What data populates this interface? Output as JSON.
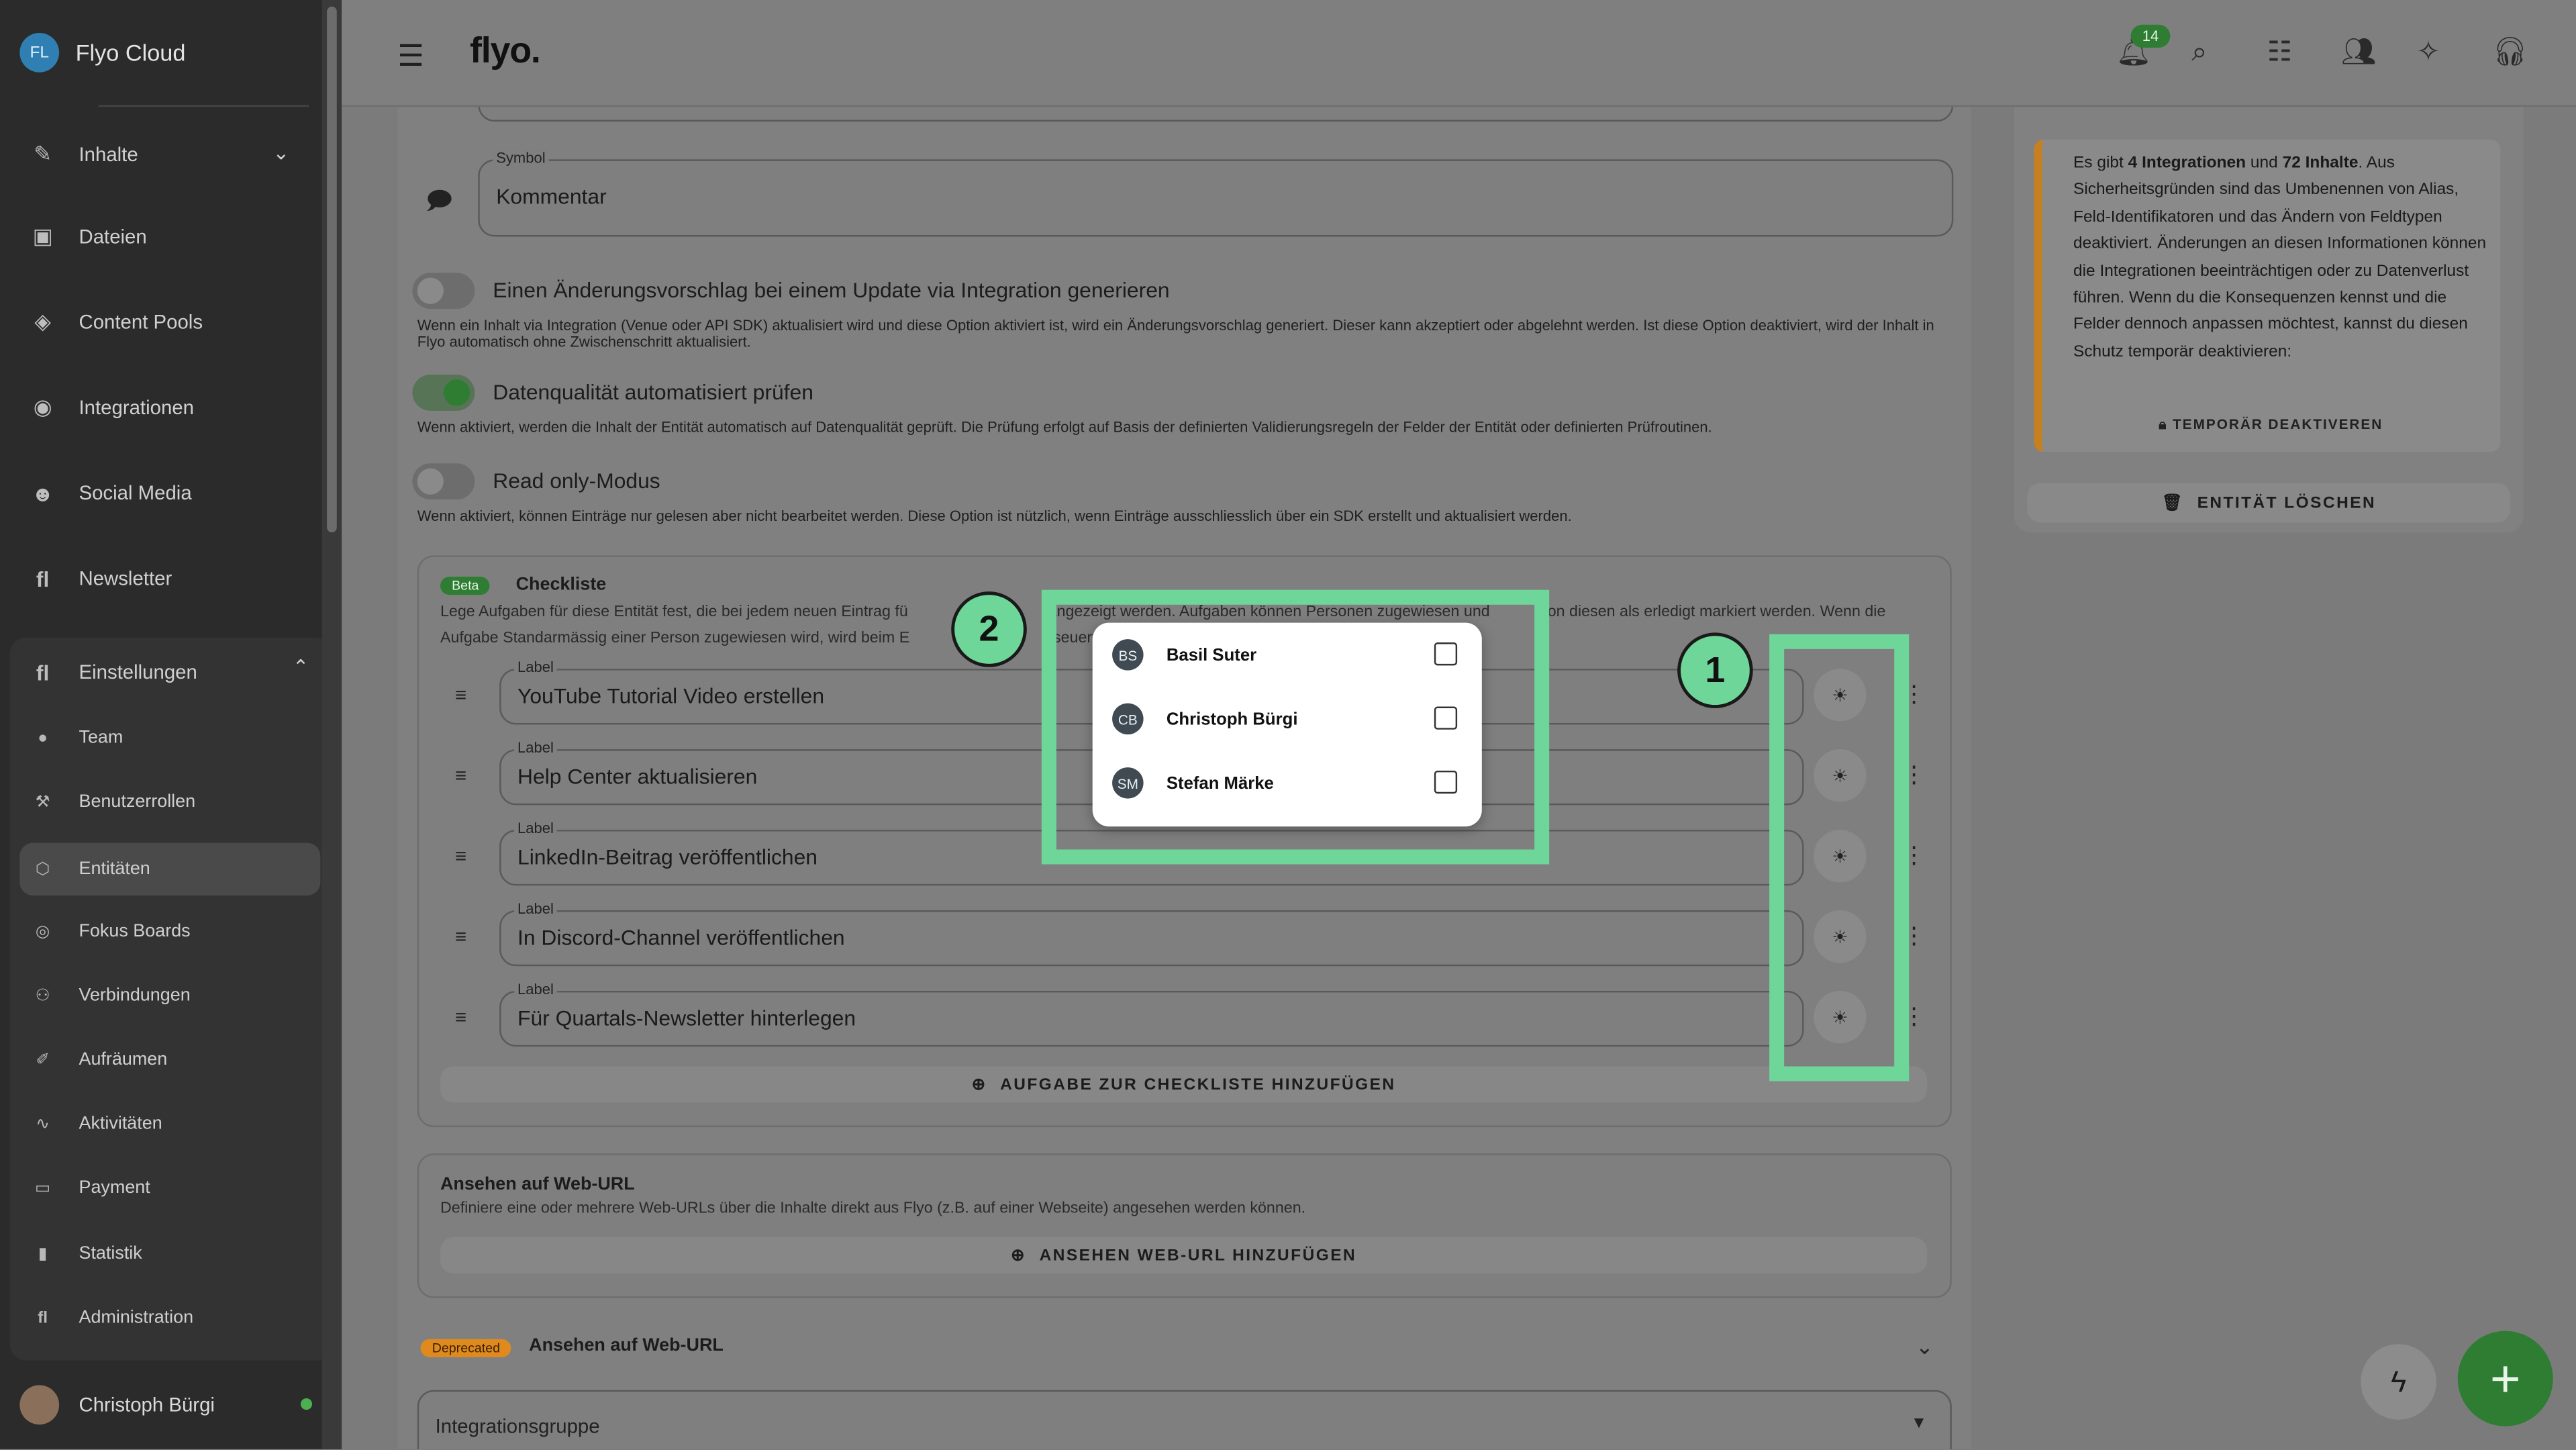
{
  "app": {
    "name": "Flyo Cloud",
    "avatar_initials": "FL",
    "logo": "flyo."
  },
  "sidebar": {
    "items": [
      {
        "label": "Inhalte",
        "icon": "pencil-icon"
      },
      {
        "label": "Dateien",
        "icon": "images-icon"
      },
      {
        "label": "Content Pools",
        "icon": "layers-icon"
      },
      {
        "label": "Integrationen",
        "icon": "integration-icon"
      },
      {
        "label": "Social Media",
        "icon": "people-icon"
      },
      {
        "label": "Newsletter",
        "icon": "flyo-icon"
      }
    ],
    "settings_group": "Einstellungen",
    "settings_items": [
      {
        "label": "Team"
      },
      {
        "label": "Benutzerrollen"
      },
      {
        "label": "Entitäten"
      },
      {
        "label": "Fokus Boards"
      },
      {
        "label": "Verbindungen"
      },
      {
        "label": "Aufräumen"
      },
      {
        "label": "Aktivitäten"
      },
      {
        "label": "Payment"
      },
      {
        "label": "Statistik"
      },
      {
        "label": "Administration"
      }
    ],
    "user": "Christoph Bürgi"
  },
  "topbar": {
    "notification_count": "14"
  },
  "form": {
    "symbol_label": "Symbol",
    "symbol_value": "Kommentar",
    "opt1_title": "Einen Änderungsvorschlag bei einem Update via Integration generieren",
    "opt1_desc": "Wenn ein Inhalt via Integration (Venue oder API SDK) aktualisiert wird und diese Option aktiviert ist, wird ein Änderungsvorschlag generiert. Dieser kann akzeptiert oder abgelehnt werden. Ist diese Option deaktiviert, wird der Inhalt in Flyo automatisch ohne Zwischenschritt aktualisiert.",
    "opt2_title": "Datenqualität automatisiert prüfen",
    "opt2_desc": "Wenn aktiviert, werden die Inhalt der Entität automatisch auf Datenqualität geprüft. Die Prüfung erfolgt auf Basis der definierten Validierungsregeln der Felder der Entität oder definierten Prüfroutinen.",
    "opt3_title": "Read only-Modus",
    "opt3_desc": "Wenn aktiviert, können Einträge nur gelesen aber nicht bearbeitet werden. Diese Option ist nützlich, wenn Einträge ausschliesslich über ein SDK erstellt und aktualisiert werden."
  },
  "checklist": {
    "badge": "Beta",
    "title": "Checkliste",
    "desc_line1": "Lege Aufgaben für diese Entität fest, die bei jedem neuen Eintrag fü",
    "desc_mid": "angezeigt werden. Aufgaben können Personen zugewiesen und",
    "desc_end": "on diesen als erledigt markiert werden. Wenn die",
    "desc_line2": "Aufgabe Standarmässig einer Person zugewiesen wird, wird beim E",
    "desc_line2_end": "seuert",
    "field_label": "Label",
    "items": [
      {
        "label": "YouTube Tutorial Video erstellen"
      },
      {
        "label": "Help Center aktualisieren"
      },
      {
        "label": "LinkedIn-Beitrag veröffentlichen"
      },
      {
        "label": "In Discord-Channel veröffentlichen"
      },
      {
        "label": "Für Quartals-Newsletter hinterlegen"
      }
    ],
    "add_button": "AUFGABE ZUR CHECKLISTE HINZUFÜGEN"
  },
  "weburl": {
    "title": "Ansehen auf Web-URL",
    "desc": "Definiere eine oder mehrere Web-URLs über die Inhalte direkt aus Flyo (z.B. auf einer Webseite) angesehen werden können.",
    "add_button": "ANSEHEN WEB-URL HINZUFÜGEN"
  },
  "deprecated": {
    "badge": "Deprecated",
    "title": "Ansehen auf Web-URL"
  },
  "integration_group": {
    "placeholder": "Integrationsgruppe"
  },
  "info": {
    "t1": "Es gibt ",
    "b1": "4 Integrationen",
    "t2": " und ",
    "b2": "72 Inhalte",
    "t3": ". Aus Sicherheitsgründen sind das Umbenennen von Alias, Feld-Identifikatoren und das Ändern von Feldtypen deaktiviert. Änderungen an diesen Informationen können die Integrationen beeinträchtigen oder zu Datenverlust führen. Wenn du die Konsequenzen kennst und die Felder dennoch anpassen möchtest, kannst du diesen Schutz temporär deaktivieren:",
    "temp_button": "TEMPORÄR DEAKTIVEREN",
    "delete_button": "ENTITÄT LÖSCHEN"
  },
  "assign_dropdown": {
    "people": [
      {
        "initials": "BS",
        "name": "Basil Suter"
      },
      {
        "initials": "CB",
        "name": "Christoph Bürgi"
      },
      {
        "initials": "SM",
        "name": "Stefan Märke"
      }
    ]
  },
  "callouts": {
    "one": "1",
    "two": "2"
  },
  "colors": {
    "accent_green": "#2e7d32",
    "highlight": "#6fd69a",
    "warning_orange": "#c7801f",
    "deprecated_orange": "#e08a1e"
  }
}
